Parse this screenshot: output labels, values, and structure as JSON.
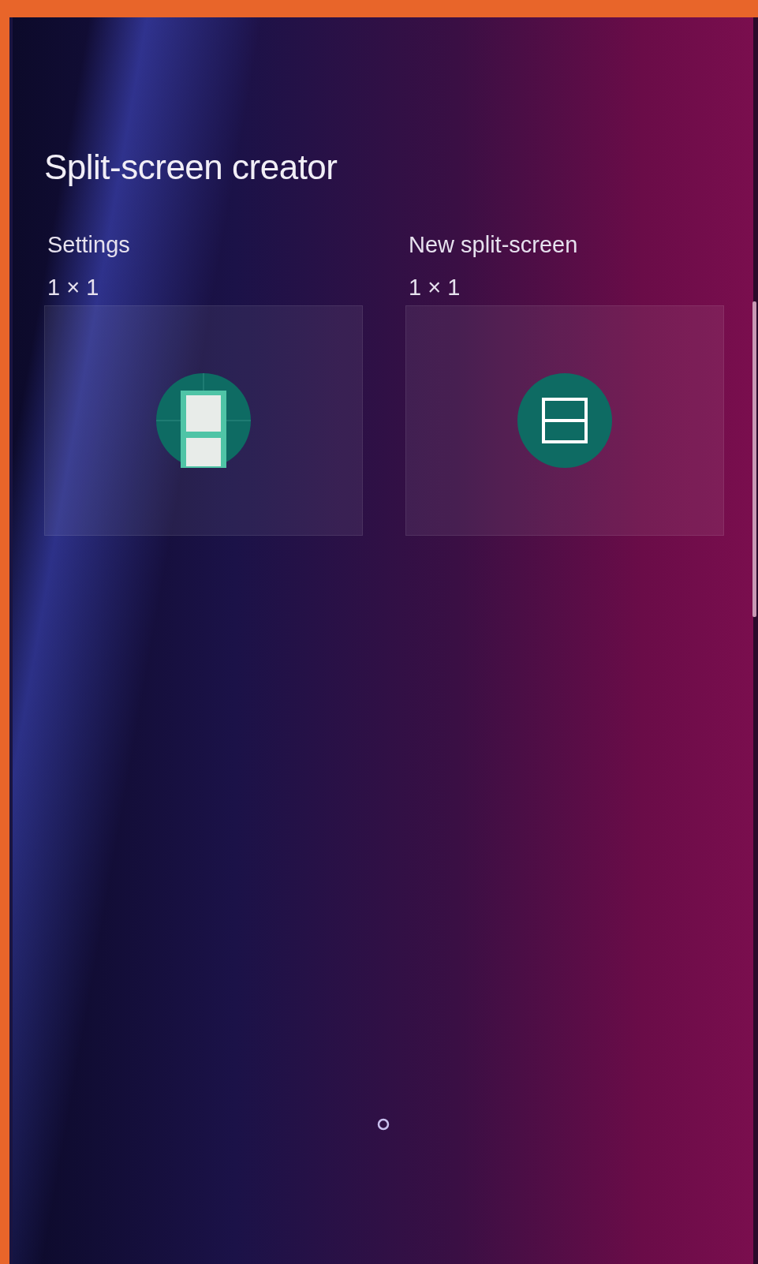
{
  "title": "Split-screen creator",
  "widgets": [
    {
      "label": "Settings",
      "size": "1 × 1",
      "kind": "settings"
    },
    {
      "label": "New split-screen",
      "size": "1 × 1",
      "kind": "split"
    }
  ]
}
